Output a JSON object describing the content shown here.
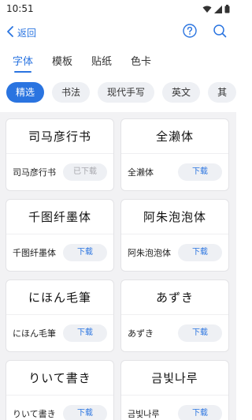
{
  "status": {
    "time": "10:51"
  },
  "header": {
    "back_label": "返回"
  },
  "tabs": [
    {
      "label": "字体",
      "active": true
    },
    {
      "label": "模板",
      "active": false
    },
    {
      "label": "贴纸",
      "active": false
    },
    {
      "label": "色卡",
      "active": false
    }
  ],
  "chips": [
    {
      "label": "精选",
      "active": true
    },
    {
      "label": "书法",
      "active": false
    },
    {
      "label": "现代手写",
      "active": false
    },
    {
      "label": "英文",
      "active": false
    },
    {
      "label": "其",
      "active": false
    }
  ],
  "fonts": [
    {
      "preview": "司马彦行书",
      "name": "司马彦行书",
      "button": "已下载",
      "downloaded": true
    },
    {
      "preview": "全濑体",
      "name": "全濑体",
      "button": "下载",
      "downloaded": false
    },
    {
      "preview": "千图纤墨体",
      "name": "千图纤墨体",
      "button": "下载",
      "downloaded": false
    },
    {
      "preview": "阿朱泡泡体",
      "name": "阿朱泡泡体",
      "button": "下载",
      "downloaded": false
    },
    {
      "preview": "にほん毛筆",
      "name": "にほん毛筆",
      "button": "下载",
      "downloaded": false
    },
    {
      "preview": "あずき",
      "name": "あずき",
      "button": "下载",
      "downloaded": false
    },
    {
      "preview": "りいて書き",
      "name": "りいて書き",
      "button": "下载",
      "downloaded": false
    },
    {
      "preview": "금빛나루",
      "name": "금빛나루",
      "button": "下载",
      "downloaded": false
    }
  ],
  "colors": {
    "accent": "#2a74e0",
    "chip_bg": "#eef0f4",
    "content_bg": "#f2f2f4"
  }
}
